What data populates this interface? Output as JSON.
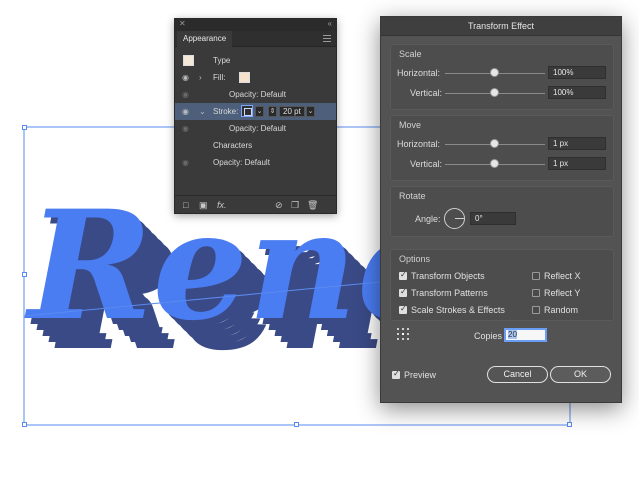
{
  "artwork": {
    "text": "Reneg",
    "fill_color": "#4a7cf2",
    "shadow_color": "#3a4a86",
    "selection_color": "#5a8bf0"
  },
  "appearance_panel": {
    "tab_label": "Appearance",
    "type_label": "Type",
    "fill_label": "Fill:",
    "fill_opacity": "Opacity: Default",
    "stroke_label": "Stroke:",
    "stroke_weight": "20 pt",
    "stroke_opacity": "Opacity: Default",
    "characters_label": "Characters",
    "characters_opacity": "Opacity: Default",
    "fx_label": "fx."
  },
  "transform_dialog": {
    "title": "Transform Effect",
    "scale": {
      "title": "Scale",
      "horizontal_label": "Horizontal:",
      "horizontal_value": "100%",
      "horizontal_position": 0.5,
      "vertical_label": "Vertical:",
      "vertical_value": "100%",
      "vertical_position": 0.5
    },
    "move": {
      "title": "Move",
      "horizontal_label": "Horizontal:",
      "horizontal_value": "1 px",
      "horizontal_position": 0.5,
      "vertical_label": "Vertical:",
      "vertical_value": "1 px",
      "vertical_position": 0.5
    },
    "rotate": {
      "title": "Rotate",
      "angle_label": "Angle:",
      "angle_value": "0°"
    },
    "options": {
      "title": "Options",
      "transform_objects": "Transform Objects",
      "transform_patterns": "Transform Patterns",
      "scale_strokes": "Scale Strokes & Effects",
      "reflect_x": "Reflect X",
      "reflect_y": "Reflect Y",
      "random": "Random"
    },
    "copies_label": "Copies",
    "copies_value": "20",
    "preview_label": "Preview",
    "cancel_label": "Cancel",
    "ok_label": "OK"
  }
}
